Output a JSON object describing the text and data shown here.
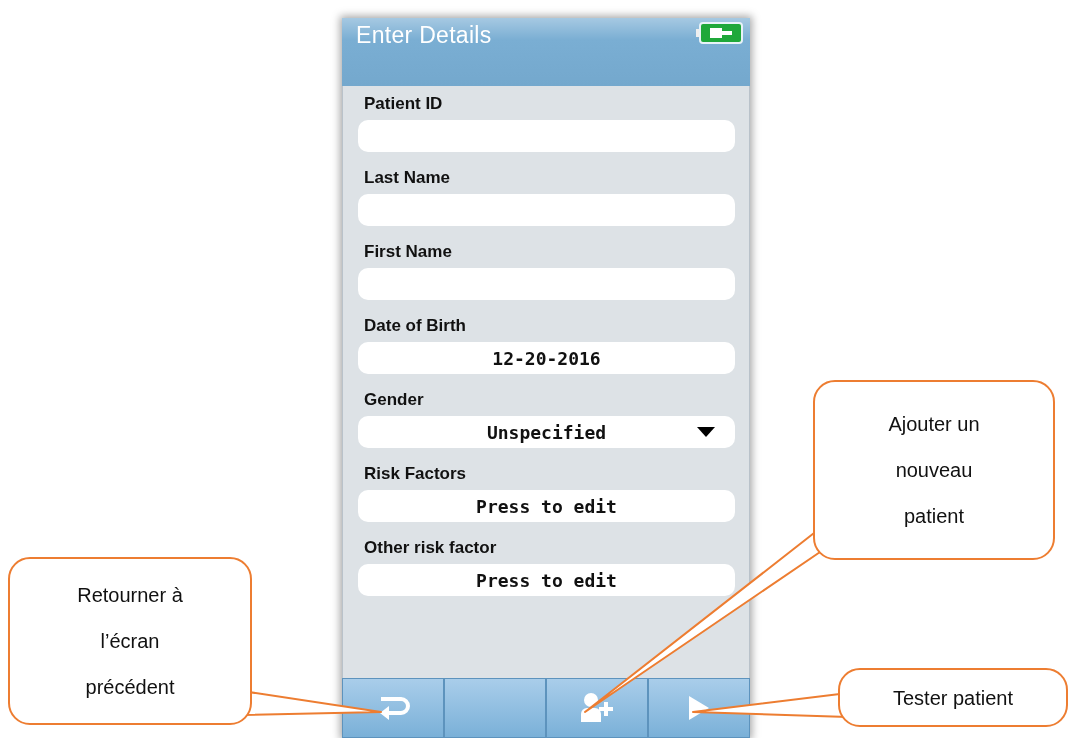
{
  "header": {
    "title": "Enter Details"
  },
  "fields": [
    {
      "label": "Patient ID",
      "kind": "text"
    },
    {
      "label": "Last Name",
      "kind": "text"
    },
    {
      "label": "First Name",
      "kind": "text"
    },
    {
      "label": "Date of Birth",
      "kind": "text",
      "value": "12-20-2016"
    },
    {
      "label": "Gender",
      "kind": "dropdown",
      "value": "Unspecified"
    },
    {
      "label": "Risk Factors",
      "kind": "button",
      "value": "Press to edit"
    },
    {
      "label": "Other risk factor",
      "kind": "button",
      "value": "Press to edit"
    }
  ],
  "toolbar": [
    {
      "kind": "back"
    },
    {
      "kind": "blank"
    },
    {
      "kind": "add-patient"
    },
    {
      "kind": "play"
    }
  ],
  "callouts": [
    {
      "text": "Retourner à l’écran précédent"
    },
    {
      "text": "Ajouter un nouveau patient"
    },
    {
      "text": "Tester patient"
    }
  ]
}
